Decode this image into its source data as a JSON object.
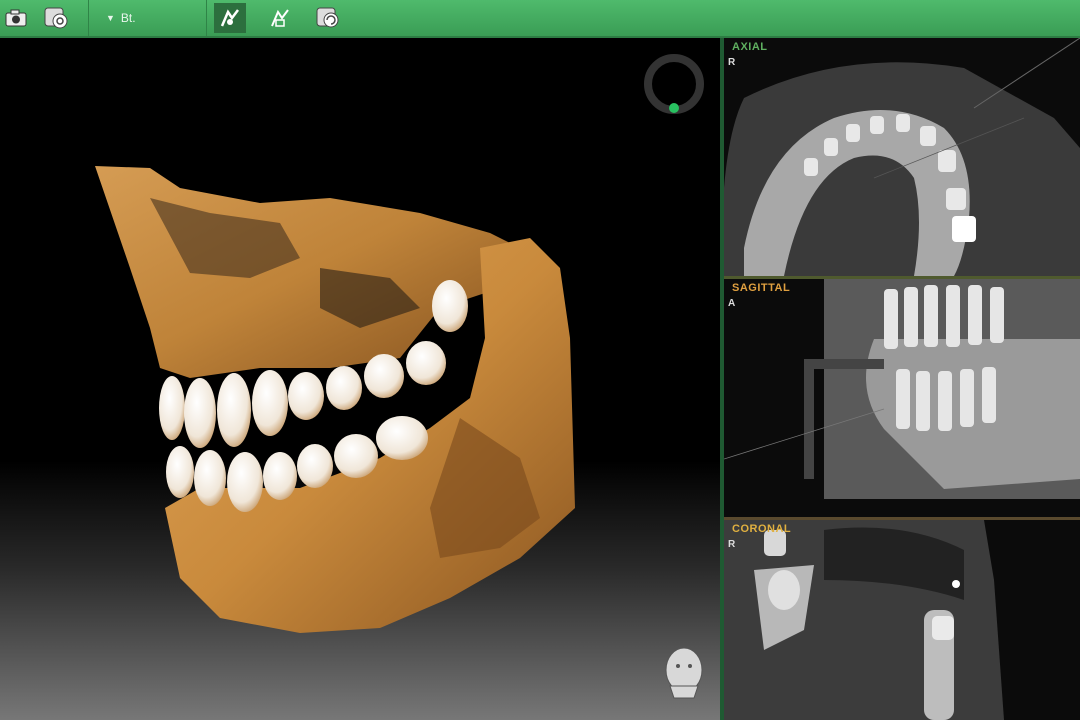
{
  "toolbar": {
    "dropdown_label": "Bt.",
    "buttons": [
      "camera-icon",
      "scan-icon",
      "jaw-view-icon",
      "jaw-view-alt-icon",
      "rotate-icon"
    ]
  },
  "panes": {
    "axial": {
      "label": "AXIAL",
      "orientation": "R",
      "color": "#5fb060"
    },
    "sagittal": {
      "label": "SAGITTAL",
      "orientation": "A",
      "color": "#e0a040"
    },
    "coronal": {
      "label": "CORONAL",
      "orientation": "R",
      "color": "#e0b040"
    }
  },
  "colors": {
    "toolbar": "#4fba6c",
    "bone": "#c98a3c",
    "accent": "#28c060"
  }
}
